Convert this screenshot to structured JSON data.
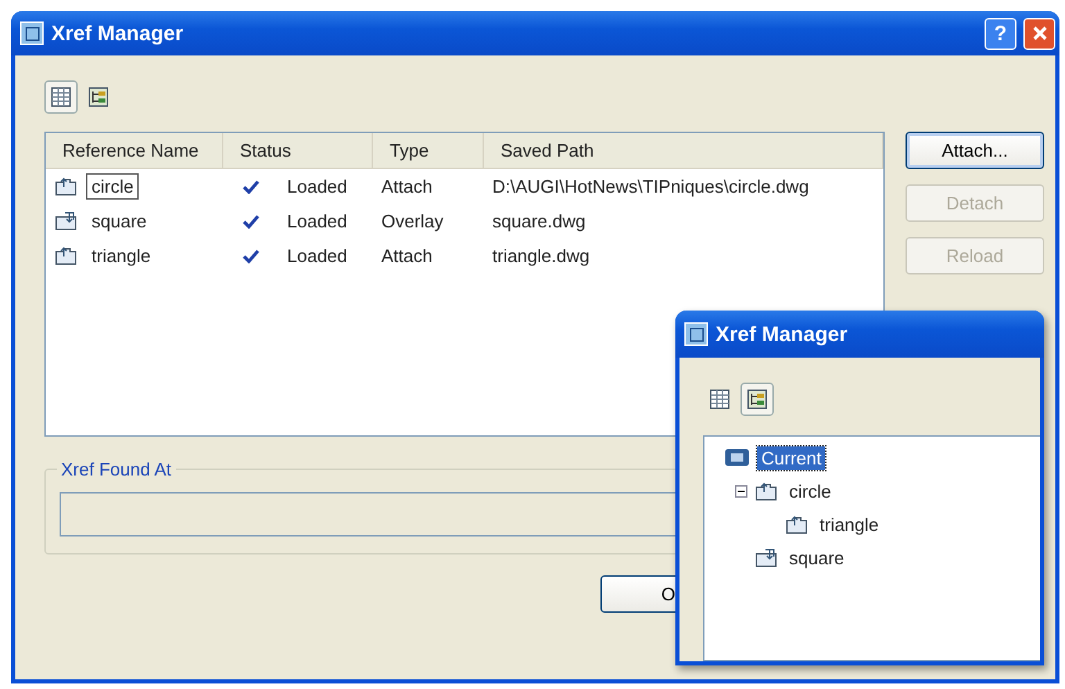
{
  "window": {
    "title": "Xref Manager",
    "help": "?"
  },
  "view_buttons": [
    {
      "kind": "list",
      "selected": true
    },
    {
      "kind": "tree",
      "selected": false
    }
  ],
  "table": {
    "columns": [
      "Reference Name",
      "Status",
      "Type",
      "Saved Path"
    ],
    "rows": [
      {
        "kind": "attach",
        "name": "circle",
        "focused": true,
        "status": "Loaded",
        "type": "Attach",
        "path": "D:\\AUGI\\HotNews\\TIPniques\\circle.dwg"
      },
      {
        "kind": "overlay",
        "name": "square",
        "focused": false,
        "status": "Loaded",
        "type": "Overlay",
        "path": "square.dwg"
      },
      {
        "kind": "attach",
        "name": "triangle",
        "focused": false,
        "status": "Loaded",
        "type": "Attach",
        "path": "triangle.dwg"
      }
    ]
  },
  "side_buttons": [
    {
      "label": "Attach...",
      "disabled": false
    },
    {
      "label": "Detach",
      "disabled": true
    },
    {
      "label": "Reload",
      "disabled": true
    }
  ],
  "found_at": {
    "label": "Xref Found At"
  },
  "ok_button": {
    "label": "O"
  },
  "overlay_window": {
    "title": "Xref Manager",
    "view_buttons": [
      {
        "kind": "list",
        "selected": false
      },
      {
        "kind": "tree",
        "selected": true
      }
    ],
    "tree": [
      {
        "kind": "drawing",
        "label": "Current",
        "selected": true,
        "children": [
          {
            "kind": "attach",
            "label": "circle",
            "selected": false,
            "expanded": true,
            "children": [
              {
                "kind": "attach",
                "label": "triangle",
                "selected": false
              }
            ]
          },
          {
            "kind": "overlay",
            "label": "square",
            "selected": false
          }
        ]
      }
    ]
  }
}
